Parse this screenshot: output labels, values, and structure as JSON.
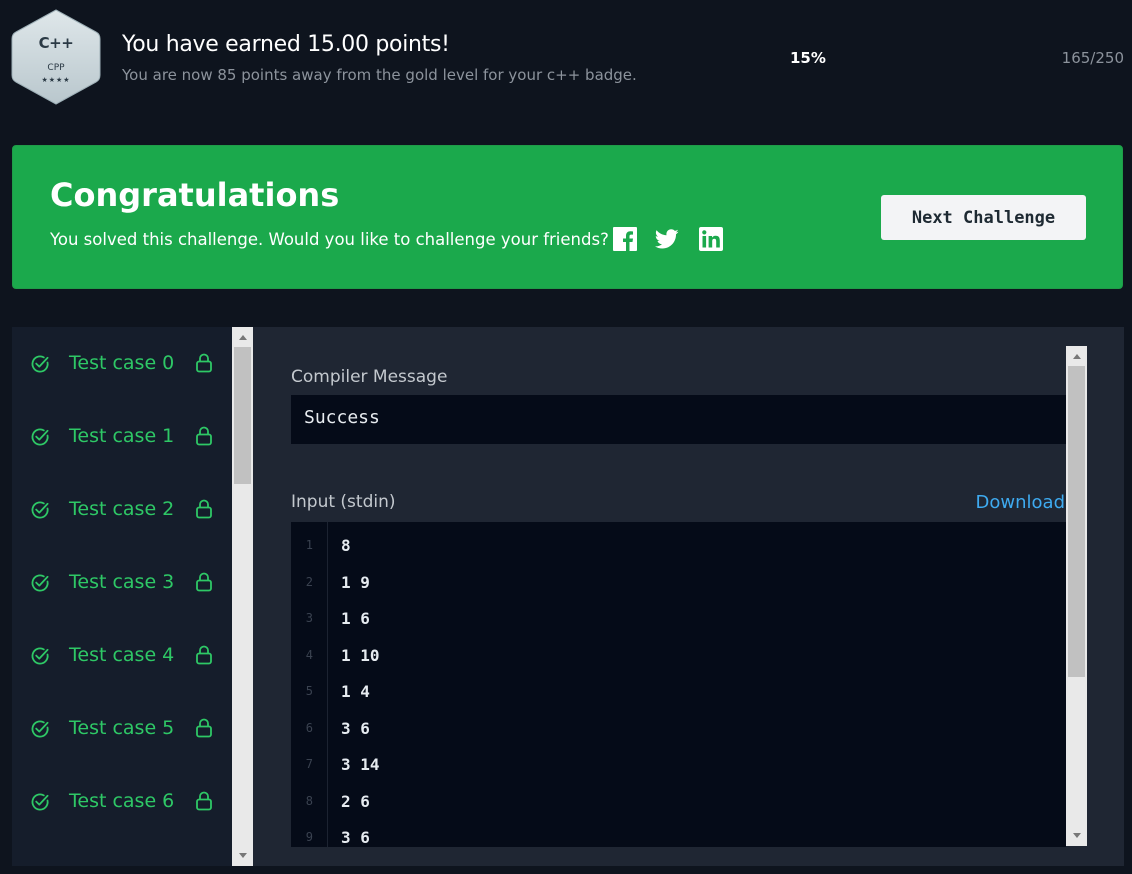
{
  "badge": {
    "lang": "C++",
    "code": "CPP",
    "stars": "★★★★"
  },
  "header": {
    "title": "You have earned 15.00 points!",
    "subtitle": "You are now 85 points away from the gold level for your c++ badge.",
    "progress_percent": "15%",
    "progress_count": "165/250"
  },
  "banner": {
    "title": "Congratulations",
    "message": "You solved this challenge. Would you like to challenge your friends?",
    "share_icons": [
      "facebook-icon",
      "twitter-icon",
      "linkedin-icon"
    ],
    "next_button": "Next Challenge",
    "color": "#1ba94c"
  },
  "test_cases": [
    {
      "label": "Test case 0",
      "status": "passed"
    },
    {
      "label": "Test case 1",
      "status": "passed"
    },
    {
      "label": "Test case 2",
      "status": "passed"
    },
    {
      "label": "Test case 3",
      "status": "passed"
    },
    {
      "label": "Test case 4",
      "status": "passed"
    },
    {
      "label": "Test case 5",
      "status": "passed"
    },
    {
      "label": "Test case 6",
      "status": "passed"
    }
  ],
  "result": {
    "compiler_label": "Compiler Message",
    "compiler_message": "Success",
    "input_label": "Input (stdin)",
    "download_label": "Download",
    "input_lines": [
      {
        "n": "1",
        "text": "8"
      },
      {
        "n": "2",
        "text": "1 9"
      },
      {
        "n": "3",
        "text": "1 6"
      },
      {
        "n": "4",
        "text": "1 10"
      },
      {
        "n": "5",
        "text": "1 4"
      },
      {
        "n": "6",
        "text": "3 6"
      },
      {
        "n": "7",
        "text": "3 14"
      },
      {
        "n": "8",
        "text": "2 6"
      },
      {
        "n": "9",
        "text": "3 6"
      }
    ]
  },
  "colors": {
    "success_green": "#2ec866",
    "link_blue": "#3eaaf0",
    "background": "#0e141e"
  }
}
